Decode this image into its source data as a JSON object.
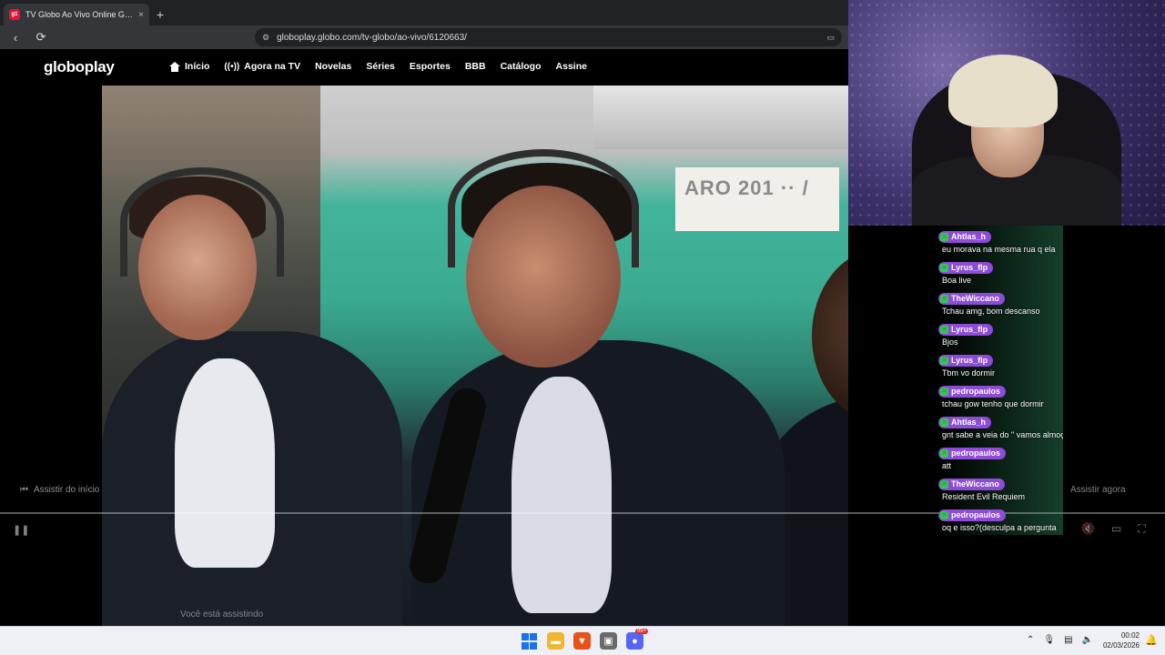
{
  "browser": {
    "tab_title": "TV Globo Ao Vivo Online Grátis |",
    "tab_favicon": "g1",
    "tab_close": "×",
    "new_tab": "+",
    "back": "‹",
    "reload": "⟳",
    "url": "globoplay.globo.com/tv-globo/ao-vivo/6120663/"
  },
  "site": {
    "logo": "globoplay",
    "nav": [
      "Início",
      "Agora na TV",
      "Novelas",
      "Séries",
      "Esportes",
      "BBB",
      "Catálogo",
      "Assine"
    ]
  },
  "video": {
    "sign_text": "ARO 201 ·· /",
    "start_label": "Assistir do início",
    "now_label": "Assistir agora",
    "watching_label": "Você está assistindo"
  },
  "chat": {
    "messages": [
      {
        "user": "Ahtlas_h",
        "text": "eu morava na mesma rua q ela"
      },
      {
        "user": "Lyrus_flp",
        "text": "Boa live"
      },
      {
        "user": "TheWiccano",
        "text": "Tchau amg, bom descanso"
      },
      {
        "user": "Lyrus_flp",
        "text": "Bjos"
      },
      {
        "user": "Lyrus_flp",
        "text": "Tbm vo dormir"
      },
      {
        "user": "pedropaulos",
        "text": "tchau gow tenho que dormir"
      },
      {
        "user": "Ahtlas_h",
        "text": "gnt sabe a veia do \" vamos almoçarrr\""
      },
      {
        "user": "pedropaulos",
        "text": "att"
      },
      {
        "user": "TheWiccano",
        "text": "Resident Evil Requiem"
      },
      {
        "user": "pedropaulos",
        "text": "oq e isso?(desculpa a pergunta"
      }
    ]
  },
  "taskbar": {
    "time": "00:02",
    "date": "02/03/2026",
    "discord_badge": "99+"
  },
  "colors": {
    "chat_badge": "#8d4bd6",
    "accent_green": "#3fbf5f",
    "tab_favicon": "#e0153b"
  }
}
